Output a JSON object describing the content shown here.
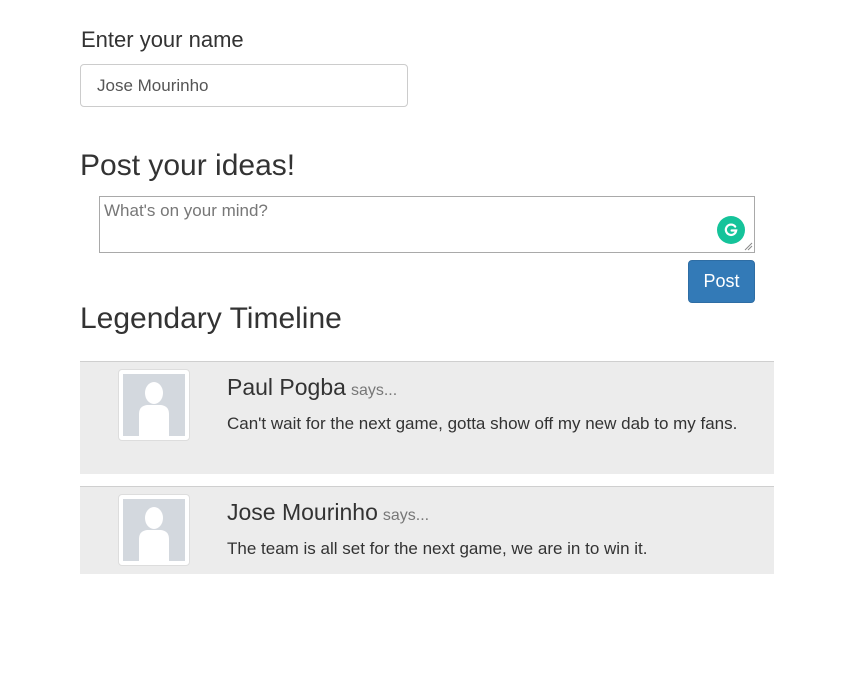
{
  "form": {
    "name_label": "Enter your name",
    "name_value": "Jose Mourinho"
  },
  "compose": {
    "heading": "Post your ideas!",
    "placeholder": "What's on your mind?",
    "post_button_label": "Post"
  },
  "timeline": {
    "heading": "Legendary Timeline",
    "posts": [
      {
        "author": "Paul Pogba",
        "says": "says...",
        "message": "Can't wait for the next game, gotta show off my new dab to my fans."
      },
      {
        "author": "Jose Mourinho",
        "says": "says...",
        "message": "The team is all set for the next game, we are in to win it."
      }
    ]
  },
  "colors": {
    "primary_button": "#337ab7",
    "post_background": "#ececec",
    "grammarly_green": "#15c39a"
  },
  "icons": {
    "avatar": "default-user-avatar-icon",
    "grammarly": "grammarly-icon"
  }
}
